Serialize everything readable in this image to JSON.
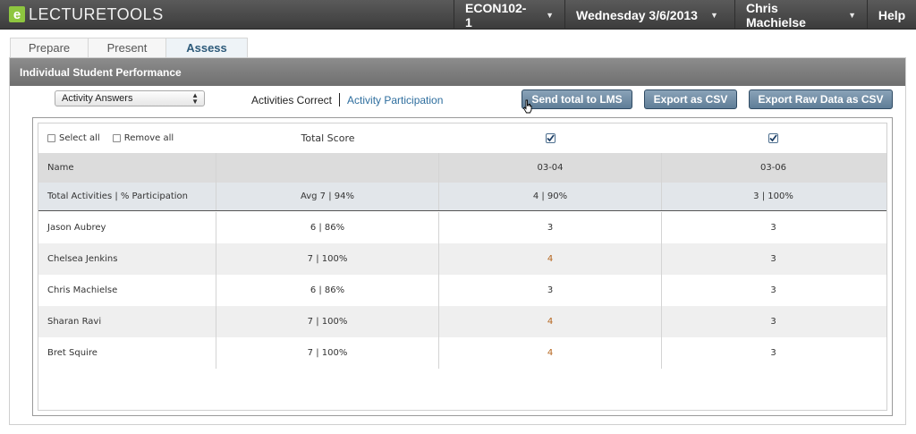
{
  "app": {
    "logo_mark": "e",
    "logo_text": "LECTURETOOLS",
    "course": "ECON102-1",
    "date": "Wednesday 3/6/2013",
    "user": "Chris Machielse",
    "help": "Help"
  },
  "tabs": [
    {
      "label": "Prepare",
      "active": false
    },
    {
      "label": "Present",
      "active": false
    },
    {
      "label": "Assess",
      "active": true
    }
  ],
  "panel": {
    "title": "Individual Student Performance",
    "dropdown_value": "Activity Answers",
    "view_active": "Activities Correct",
    "view_other": "Activity Participation",
    "buttons": {
      "send_lms": "Send total to LMS",
      "export_csv": "Export as CSV",
      "export_raw": "Export Raw Data as CSV"
    }
  },
  "table": {
    "select_all": "Select all",
    "remove_all": "Remove all",
    "total_score_label": "Total Score",
    "col_name": "Name",
    "col_total": "",
    "date_cols": [
      "03-04",
      "03-06"
    ],
    "totals_label": "Total Activities | % Participation",
    "totals": [
      "Avg 7 | 94%",
      "4 | 90%",
      "3 | 100%"
    ],
    "students": [
      {
        "name": "Jason Aubrey",
        "total": "6 | 86%",
        "d1": "3",
        "d2": "3"
      },
      {
        "name": "Chelsea Jenkins",
        "total": "7 | 100%",
        "d1": "4",
        "d2": "3"
      },
      {
        "name": "Chris Machielse",
        "total": "6 | 86%",
        "d1": "3",
        "d2": "3"
      },
      {
        "name": "Sharan Ravi",
        "total": "7 | 100%",
        "d1": "4",
        "d2": "3"
      },
      {
        "name": "Bret Squire",
        "total": "7 | 100%",
        "d1": "4",
        "d2": "3"
      }
    ]
  },
  "colors": {
    "topbar": "#4a4a4a",
    "panel_header": "#7d7d7d",
    "button": "#6f8ba5",
    "link": "#2e6e9e",
    "logo_green": "#8ec63f"
  }
}
